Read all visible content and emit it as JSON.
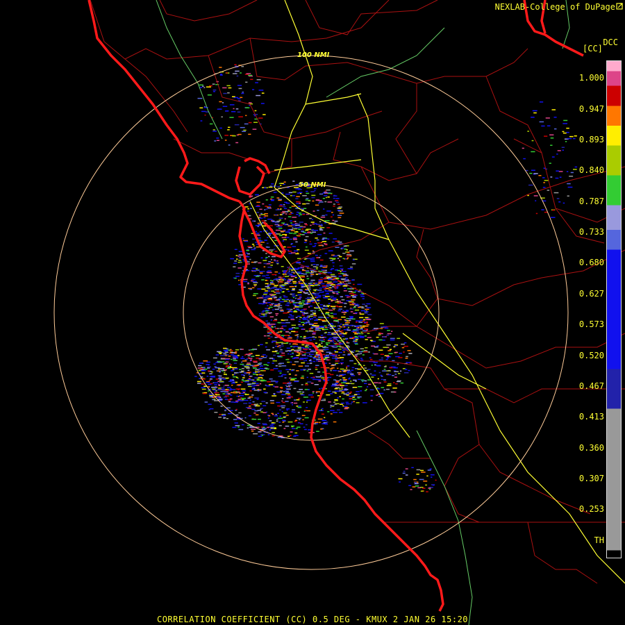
{
  "header": {
    "credit": "NEXLAB-College of DuPage",
    "product_code": "DCC",
    "product_abbr": "[CC]"
  },
  "caption": "CORRELATION COEFFICIENT (CC) 0.5 DEG - KMUX 2 JAN 26 15:20",
  "range_rings": [
    {
      "label": "50 NMI"
    },
    {
      "label": "100 NMI"
    }
  ],
  "colorbar": {
    "ticks": [
      "1.000",
      "0.947",
      "0.893",
      "0.840",
      "0.787",
      "0.733",
      "0.680",
      "0.627",
      "0.573",
      "0.520",
      "0.467",
      "0.413",
      "0.360",
      "0.307",
      "0.253",
      "TH"
    ],
    "colors": {
      "top_pink": "#ffaacc",
      "magenta": "#dd4488",
      "red": "#cc0000",
      "orange": "#ff7700",
      "yellow": "#ffee00",
      "yellow_green": "#aacc00",
      "green": "#33cc33",
      "lavender": "#9999dd",
      "periwinkle": "#5566dd",
      "blue": "#1111ee",
      "navy": "#2222aa",
      "gray": "#999999",
      "black": "#000000"
    }
  },
  "colors": {
    "background": "#000000",
    "coast": "#ff1a1a",
    "county": "#aa1111",
    "highway": "#ffff33",
    "state_line": "#66cc66",
    "range_ring": "#ffcc99",
    "label": "#ffff33"
  }
}
